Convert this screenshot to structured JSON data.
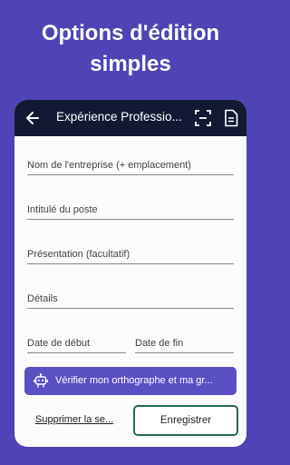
{
  "promo": {
    "line1": "Options d'édition",
    "line2": "simples"
  },
  "appbar": {
    "title": "Expérience Professio...",
    "back_icon": "arrow-left-icon",
    "scan_icon": "scan-icon",
    "document_icon": "document-icon"
  },
  "form": {
    "company_placeholder": "Nom de l'entreprise (+ emplacement)",
    "job_title_placeholder": "Intitulé du poste",
    "summary_placeholder": "Présentation (facultatif)",
    "details_placeholder": "Détails",
    "start_date_placeholder": "Date de début",
    "end_date_placeholder": "Date de fin"
  },
  "actions": {
    "spellcheck_label": "Vérifier mon orthographe et ma gr...",
    "spellcheck_icon": "robot-icon",
    "delete_label": "Supprimer la se...",
    "save_label": "Enregistrer"
  },
  "colors": {
    "background": "#4f43b6",
    "appbar": "#121a33",
    "spellcheck_button": "#5b4fc4",
    "save_border": "#27665a"
  }
}
